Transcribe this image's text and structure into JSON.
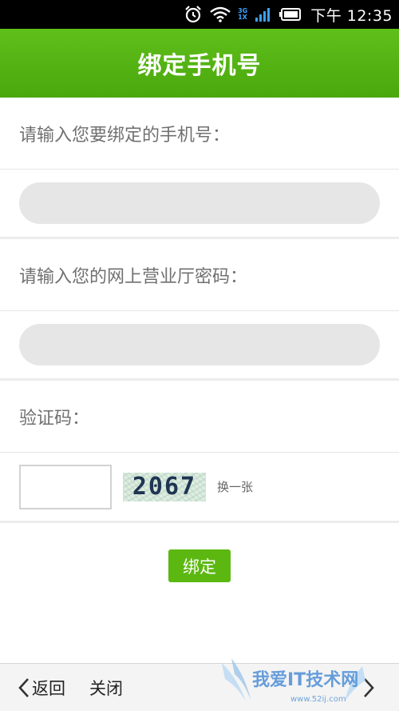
{
  "status_bar": {
    "network_label_top": "3G",
    "network_label_bottom": "1X",
    "time": "下午 12:35",
    "icons": [
      "alarm-icon",
      "wifi-icon",
      "signal-icon",
      "battery-icon"
    ]
  },
  "header": {
    "title": "绑定手机号",
    "color": "#55b514"
  },
  "form": {
    "phone_label": "请输入您要绑定的手机号：",
    "phone_value": "",
    "password_label": "请输入您的网上营业厅密码：",
    "password_value": "",
    "captcha_label": "验证码：",
    "captcha_value": "",
    "captcha_image_text": "2067",
    "refresh_label": "换一张",
    "submit_label": "绑定"
  },
  "bottom_bar": {
    "back_label": "返回",
    "close_label": "关闭"
  },
  "watermark": {
    "text": "我爱IT技术网",
    "url": "www.52ij.com"
  }
}
